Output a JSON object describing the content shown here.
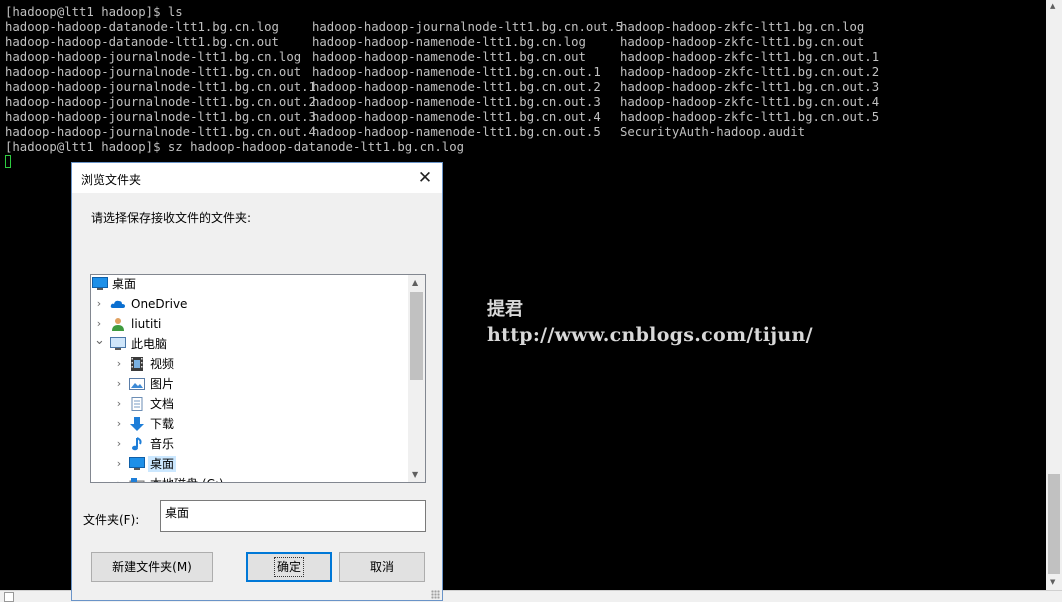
{
  "terminal": {
    "columns": [
      [
        "[hadoop@ltt1 hadoop]$ ls",
        "hadoop-hadoop-datanode-ltt1.bg.cn.log",
        "hadoop-hadoop-datanode-ltt1.bg.cn.out",
        "hadoop-hadoop-journalnode-ltt1.bg.cn.log",
        "hadoop-hadoop-journalnode-ltt1.bg.cn.out",
        "hadoop-hadoop-journalnode-ltt1.bg.cn.out.1",
        "hadoop-hadoop-journalnode-ltt1.bg.cn.out.2",
        "hadoop-hadoop-journalnode-ltt1.bg.cn.out.3",
        "hadoop-hadoop-journalnode-ltt1.bg.cn.out.4"
      ],
      [
        "",
        "hadoop-hadoop-journalnode-ltt1.bg.cn.out.5",
        "hadoop-hadoop-namenode-ltt1.bg.cn.log",
        "hadoop-hadoop-namenode-ltt1.bg.cn.out",
        "hadoop-hadoop-namenode-ltt1.bg.cn.out.1",
        "hadoop-hadoop-namenode-ltt1.bg.cn.out.2",
        "hadoop-hadoop-namenode-ltt1.bg.cn.out.3",
        "hadoop-hadoop-namenode-ltt1.bg.cn.out.4",
        "hadoop-hadoop-namenode-ltt1.bg.cn.out.5"
      ],
      [
        "",
        "hadoop-hadoop-zkfc-ltt1.bg.cn.log",
        "hadoop-hadoop-zkfc-ltt1.bg.cn.out",
        "hadoop-hadoop-zkfc-ltt1.bg.cn.out.1",
        "hadoop-hadoop-zkfc-ltt1.bg.cn.out.2",
        "hadoop-hadoop-zkfc-ltt1.bg.cn.out.3",
        "hadoop-hadoop-zkfc-ltt1.bg.cn.out.4",
        "hadoop-hadoop-zkfc-ltt1.bg.cn.out.5",
        "SecurityAuth-hadoop.audit"
      ]
    ],
    "command_line": "[hadoop@ltt1 hadoop]$ sz hadoop-hadoop-datanode-ltt1.bg.cn.log",
    "text_color": "#c0c0c0",
    "cursor_color": "#2ecc40"
  },
  "watermark": {
    "name": "提君",
    "url": "http://www.cnblogs.com/tijun/"
  },
  "dialog": {
    "title": "浏览文件夹",
    "prompt": "请选择保存接收文件的文件夹:",
    "tree": [
      {
        "label": "桌面",
        "icon": "desktop-icon",
        "level": 0,
        "chevron": "",
        "selected": false
      },
      {
        "label": "OneDrive",
        "icon": "cloud-icon",
        "level": 1,
        "chevron": "right",
        "selected": false
      },
      {
        "label": "liutiti",
        "icon": "user-icon",
        "level": 1,
        "chevron": "right",
        "selected": false
      },
      {
        "label": "此电脑",
        "icon": "computer-icon",
        "level": 1,
        "chevron": "down",
        "selected": false
      },
      {
        "label": "视频",
        "icon": "video-icon",
        "level": 2,
        "chevron": "right",
        "selected": false
      },
      {
        "label": "图片",
        "icon": "pictures-icon",
        "level": 2,
        "chevron": "right",
        "selected": false
      },
      {
        "label": "文档",
        "icon": "documents-icon",
        "level": 2,
        "chevron": "right",
        "selected": false
      },
      {
        "label": "下载",
        "icon": "download-icon",
        "level": 2,
        "chevron": "right",
        "selected": false
      },
      {
        "label": "音乐",
        "icon": "music-icon",
        "level": 2,
        "chevron": "right",
        "selected": false
      },
      {
        "label": "桌面",
        "icon": "desktop-icon",
        "level": 2,
        "chevron": "right",
        "selected": true
      },
      {
        "label": "本地磁盘 (C:)",
        "icon": "drive-icon",
        "level": 2,
        "chevron": "right",
        "selected": false
      }
    ],
    "folder_label": "文件夹(F):",
    "folder_value": "桌面",
    "buttons": {
      "new_folder": "新建文件夹(M)",
      "ok": "确定",
      "cancel": "取消"
    },
    "accent_color": "#0078d7",
    "selection_color": "#cce8ff"
  }
}
